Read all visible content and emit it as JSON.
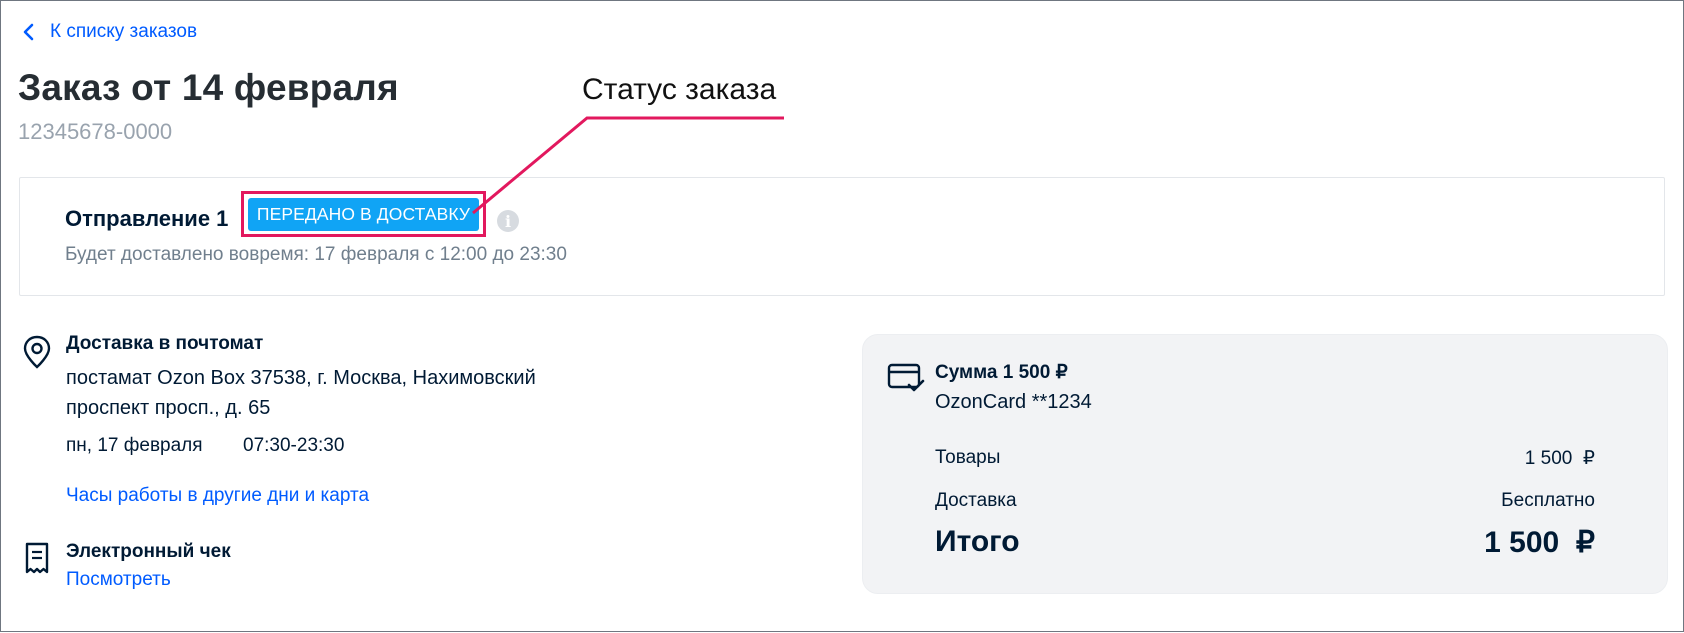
{
  "nav": {
    "back_label": "К списку заказов"
  },
  "order": {
    "title": "Заказ от 14 февраля",
    "number": "12345678-0000"
  },
  "annotation": {
    "label": "Статус заказа",
    "color": "#e2185e"
  },
  "shipment": {
    "title": "Отправление 1",
    "status": "ПЕРЕДАНО В ДОСТАВКУ",
    "info_icon": "i",
    "delivery_note": "Будет доставлено вовремя: 17 февраля с 12:00 до 23:30"
  },
  "delivery": {
    "icon": "map-pin-icon",
    "title": "Доставка в почтомат",
    "address": "постамат Ozon Box 37538, г. Москва, Нахимовский проспект просп., д. 65",
    "date": "пн, 17 февраля",
    "hours": "07:30-23:30",
    "hours_link": "Часы работы в другие дни и карта"
  },
  "receipt": {
    "icon": "receipt-icon",
    "title": "Электронный чек",
    "link": "Посмотреть"
  },
  "summary": {
    "icon": "credit-card-icon",
    "title": "Сумма 1 500 ₽",
    "card": "OzonCard **1234",
    "goods_label": "Товары",
    "goods_value": "1 500  ₽",
    "delivery_label": "Доставка",
    "delivery_value": "Бесплатно",
    "total_label": "Итого",
    "total_value": "1 500  ₽"
  },
  "colors": {
    "link": "#005bff",
    "status_badge": "#10a4f5",
    "text_primary": "#001a34",
    "text_secondary": "#707f8d"
  }
}
